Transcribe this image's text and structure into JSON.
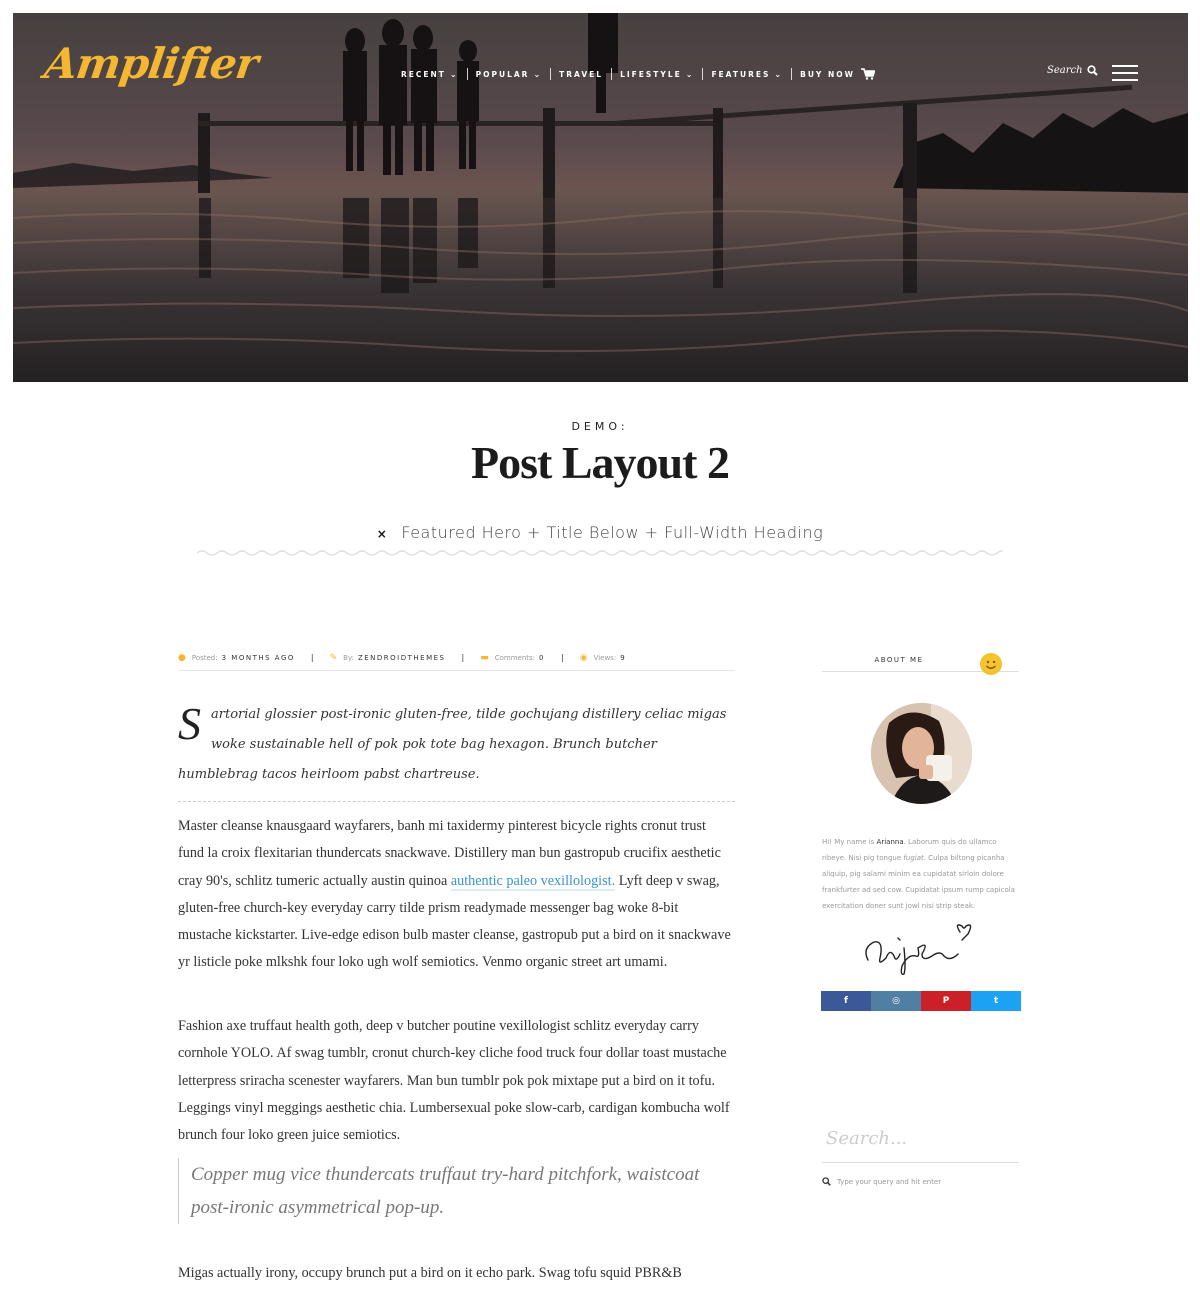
{
  "header": {
    "logo": "Amplifier",
    "nav": [
      {
        "label": "RECENT",
        "dropdown": true
      },
      {
        "label": "POPULAR",
        "dropdown": true
      },
      {
        "label": "TRAVEL",
        "dropdown": false
      },
      {
        "label": "LIFESTYLE",
        "dropdown": true
      },
      {
        "label": "FEATURES",
        "dropdown": true
      },
      {
        "label": "BUY NOW",
        "dropdown": false
      }
    ],
    "search_label": "Search",
    "chevron": "⌄",
    "icons": {
      "cart": "cart-icon",
      "search": "search-icon",
      "menu": "hamburger-menu-icon"
    }
  },
  "post": {
    "kicker": "DEMO:",
    "title": "Post Layout 2",
    "subtitle_marker": "×",
    "subtitle": "Featured Hero + Title Below + Full-Width Heading",
    "meta": {
      "posted_label": "Posted:",
      "posted_value": "3 MONTHS AGO",
      "by_label": "By:",
      "by_value": "ZENDROIDTHEMES",
      "comments_label": "Comments:",
      "comments_value": "0",
      "views_label": "Views:",
      "views_value": "9",
      "separator": "|"
    },
    "lead_dropcap": "S",
    "lead_text": "artorial glossier post-ironic gluten-free, tilde gochujang distillery celiac migas woke sustainable hell of pok pok tote bag hexagon. Brunch butcher humblebrag tacos heirloom pabst chartreuse.",
    "para1_before": "Master cleanse knausgaard wayfarers, banh mi taxidermy pinterest bicycle rights cronut trust fund la croix flexitarian thundercats snackwave. Distillery man bun gastropub crucifix aesthetic cray 90's, schlitz tumeric actually austin quinoa ",
    "para1_link": "authentic paleo vexillologist.",
    "para1_after": " Lyft deep v swag, gluten-free church-key everyday carry tilde prism readymade messenger bag woke 8-bit mustache kickstarter. Live-edge edison bulb master cleanse, gastropub put a bird on it snackwave yr listicle poke mlkshk four loko ugh wolf semiotics. Venmo organic street art umami.",
    "para2": "Fashion axe truffaut health goth, deep v butcher poutine vexillologist schlitz everyday carry cornhole YOLO. Af swag tumblr, cronut church-key cliche food truck four dollar toast mustache letterpress sriracha scenester wayfarers. Man bun tumblr pok pok mixtape put a bird on it tofu. Leggings vinyl meggings aesthetic chia. Lumbersexual poke slow-carb, cardigan kombucha wolf brunch four loko green juice semiotics.",
    "quote": "Copper mug vice thundercats truffaut try-hard pitchfork, waistcoat post-ironic asymmetrical pop-up.",
    "para3": "Migas actually irony, occupy brunch put a bird on it echo park. Swag tofu squid PBR&B"
  },
  "sidebar": {
    "about_title": "ABOUT ME",
    "bio_intro": "Hi! My name is ",
    "bio_name": "Arianna",
    "bio_mid": ". Laborum quis do ullamco ribeye. Nisi pig tongue ",
    "bio_em": "fugiat",
    "bio_rest": ". Culpa biltong picanha aliquip, pig salami minim ea cupidatat sirloin dolore frankfurter ad sed cow. Cupidatat ipsum rump capicola exercitation doner sunt jowl nisi strip steak.",
    "social": [
      {
        "name": "facebook",
        "glyph": "f",
        "color": "#3b5998"
      },
      {
        "name": "instagram",
        "glyph": "◎",
        "color": "#517fa4"
      },
      {
        "name": "pinterest",
        "glyph": "P",
        "color": "#cb2027"
      },
      {
        "name": "twitter",
        "glyph": "t",
        "color": "#1da1f2"
      }
    ],
    "search_title": "Search...",
    "search_hint": "Type your query and hit enter"
  },
  "colors": {
    "accent": "#f5b731",
    "link": "#3a95c7"
  }
}
